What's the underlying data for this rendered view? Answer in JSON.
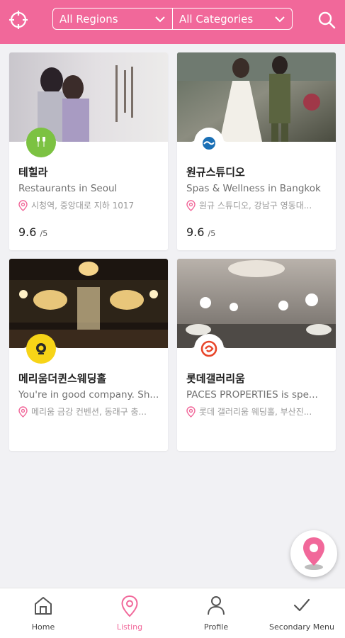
{
  "header": {
    "regions_label": "All Regions",
    "categories_label": "All Categories"
  },
  "cards": [
    {
      "name": "테힐라",
      "category": "Restaurants in Seoul",
      "address": "시청역, 중앙대로 지하 1017",
      "score": "9.6",
      "score_max": "/5",
      "logo_color": "#7cc242",
      "logo_icon": "wine-glasses-icon"
    },
    {
      "name": "원규스튜디오",
      "category": "Spas & Wellness in Bangkok",
      "address": "원규 스튜디오, 강남구 영동대...",
      "score": "9.6",
      "score_max": "/5",
      "logo_color": "#1a6fb5",
      "logo_icon": "wave-logo-icon"
    },
    {
      "name": "메리움더퀸스웨딩홀",
      "category": "You're in good company. Sh...",
      "address": "메리움 금강 컨벤션, 동래구 충...",
      "logo_color": "#f7d417",
      "logo_icon": "lion-crest-icon"
    },
    {
      "name": "롯데갤러리움",
      "category": "PACES PROPERTIES is spe...",
      "address": "롯데 갤러리움 웨딩홀, 부산진...",
      "logo_color": "#e8462a",
      "logo_icon": "swirl-logo-icon"
    }
  ],
  "nav": {
    "home": "Home",
    "listing": "Listing",
    "profile": "Profile",
    "secondary": "Secondary Menu"
  },
  "colors": {
    "accent": "#f1689a",
    "background": "#f1f1f4"
  }
}
